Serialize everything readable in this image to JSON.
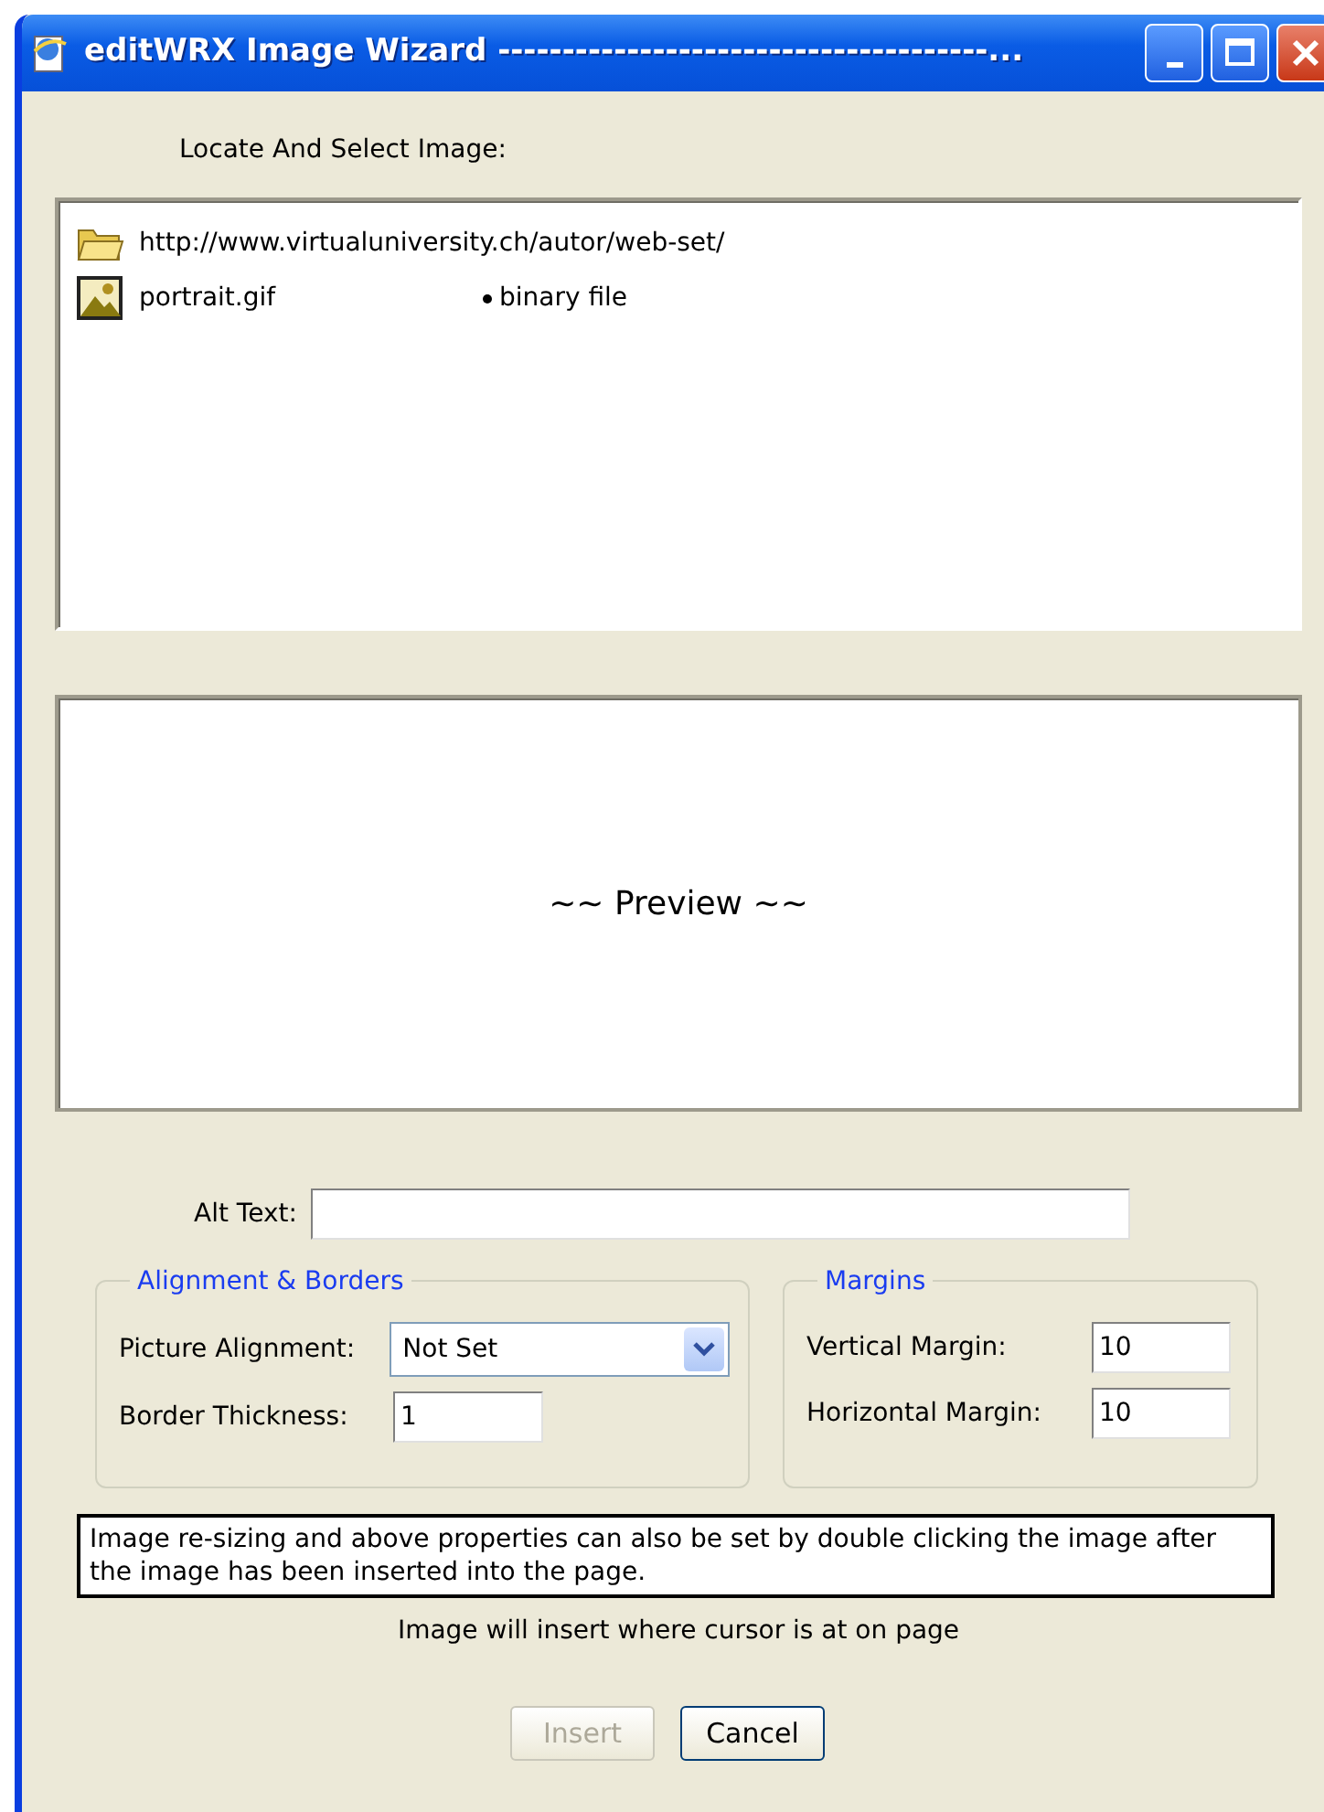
{
  "window": {
    "title": "editWRX Image Wizard --------------------------------------..."
  },
  "file_list": {
    "label": "Locate And Select Image:",
    "items": [
      {
        "kind": "folder",
        "name": "http://www.virtualuniversity.ch/autor/web-set/"
      },
      {
        "kind": "image",
        "name": "portrait.gif",
        "type": "binary file"
      }
    ]
  },
  "preview": {
    "text": "~~ Preview ~~"
  },
  "alt_text": {
    "label": "Alt Text:"
  },
  "alignment_group": {
    "title": "Alignment & Borders",
    "picture_alignment": {
      "label": "Picture Alignment:",
      "value": "Not Set"
    },
    "border_thickness": {
      "label": "Border Thickness:",
      "value": "1"
    }
  },
  "margins_group": {
    "title": "Margins",
    "vertical_margin": {
      "label": "Vertical Margin:",
      "value": "10"
    },
    "horizontal_margin": {
      "label": "Horizontal Margin:",
      "value": "10"
    }
  },
  "note": "Image re-sizing and above properties can also be set by double clicking the image after the image has been inserted into the page.",
  "hint": "Image will insert where cursor is at on page",
  "buttons": [
    {
      "label": "Insert",
      "disabled": true
    },
    {
      "label": "Cancel",
      "disabled": false
    }
  ]
}
